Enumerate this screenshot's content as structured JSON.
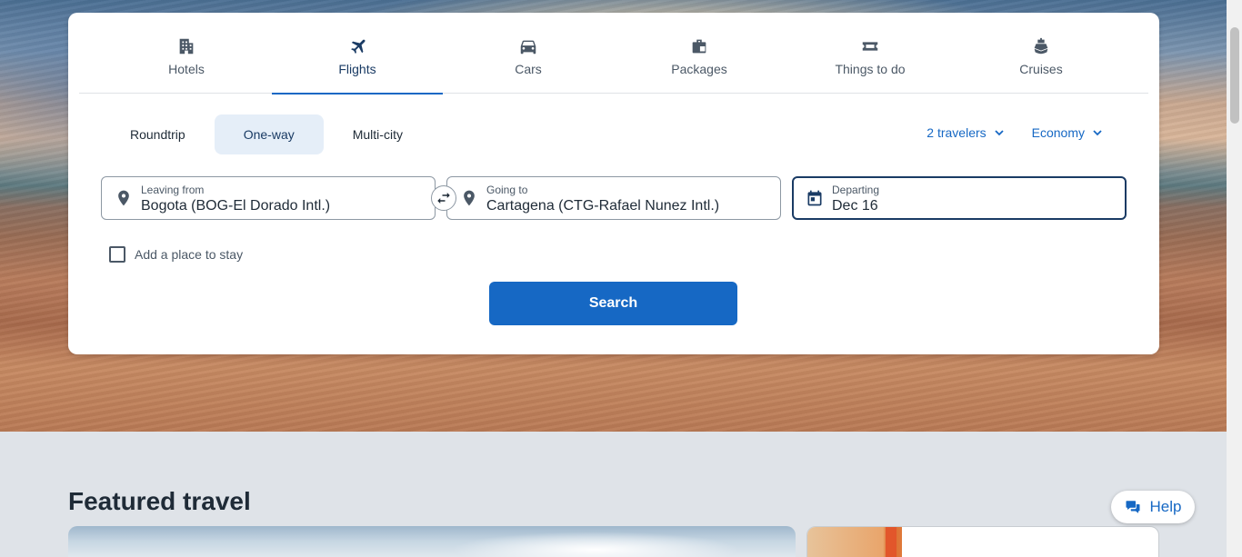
{
  "tabs": [
    {
      "label": "Hotels",
      "icon": "hotel-icon",
      "active": false
    },
    {
      "label": "Flights",
      "icon": "plane-icon",
      "active": true
    },
    {
      "label": "Cars",
      "icon": "car-icon",
      "active": false
    },
    {
      "label": "Packages",
      "icon": "suitcase-icon",
      "active": false
    },
    {
      "label": "Things to do",
      "icon": "ticket-icon",
      "active": false
    },
    {
      "label": "Cruises",
      "icon": "ship-icon",
      "active": false
    }
  ],
  "trip_types": [
    {
      "label": "Roundtrip",
      "active": false
    },
    {
      "label": "One-way",
      "active": true
    },
    {
      "label": "Multi-city",
      "active": false
    }
  ],
  "options": {
    "travelers": "2 travelers",
    "cabin": "Economy"
  },
  "fields": {
    "leaving": {
      "label": "Leaving from",
      "value": "Bogota (BOG-El Dorado Intl.)"
    },
    "going": {
      "label": "Going to",
      "value": "Cartagena (CTG-Rafael Nunez Intl.)"
    },
    "departing": {
      "label": "Departing",
      "value": "Dec 16"
    }
  },
  "add_stay_label": "Add a place to stay",
  "search_label": "Search",
  "featured_title": "Featured travel",
  "help_label": "Help",
  "colors": {
    "brand_blue": "#1668c4",
    "dark_navy": "#1a3b64",
    "active_tab_bg": "#e5eef8"
  }
}
